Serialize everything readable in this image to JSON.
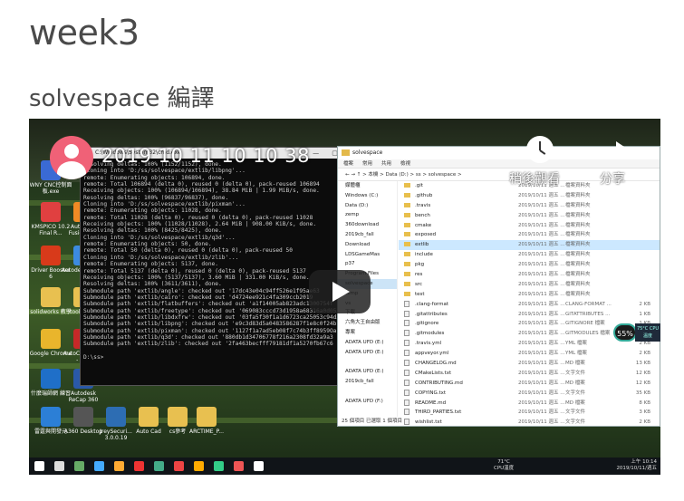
{
  "page": {
    "heading": "week3",
    "subheading": "solvespace 編譯"
  },
  "video": {
    "title": "2019 10 11 10 10 38",
    "watch_later_label": "稍後觀看",
    "share_label": "分享"
  },
  "cmd": {
    "title": "C:\\Windows\\System32\\cmd.exe",
    "lines": [
      "Resolving deltas: 100% (1152/1152), done.",
      "Cloning into 'D:/ss/solvespace/extlib/libpng'...",
      "remote: Enumerating objects: 106894, done.",
      "remote: Total 106894 (delta 0), reused 0 (delta 0), pack-reused 106894",
      "Receiving objects: 100% (106894/106894), 38.84 MiB | 1.99 MiB/s, done.",
      "Resolving deltas: 100% (96837/96837), done.",
      "Cloning into 'D:/ss/solvespace/extlib/pixman'...",
      "remote: Enumerating objects: 11028, done.",
      "remote: Total 11028 (delta 0), reused 0 (delta 0), pack-reused 11028",
      "Receiving objects: 100% (11028/11028), 2.64 MiB | 908.00 KiB/s, done.",
      "Resolving deltas: 100% (8425/8425), done.",
      "Cloning into 'D:/ss/solvespace/extlib/q3d'...",
      "remote: Enumerating objects: 50, done.",
      "remote: Total 50 (delta 0), reused 0 (delta 0), pack-reused 50",
      "Cloning into 'D:/ss/solvespace/extlib/zlib'...",
      "remote: Enumerating objects: 5137, done.",
      "remote: Total 5137 (delta 0), reused 0 (delta 0), pack-reused 5137",
      "Receiving objects: 100% (5137/5137), 3.60 MiB | 331.00 KiB/s, done.",
      "Resolving deltas: 100% (3611/3611), done.",
      "Submodule path 'extlib/angle': checked out '17dc43e04c94ff526e1f95ae63",
      "Submodule path 'extlib/cairo': checked out 'd4724ee921c4fa309ccb2019",
      "Submodule path 'extlib/flatbuffers': checked out 'a1f14005ab823adc1300754f",
      "Submodule path 'extlib/freetype': checked out '069083cccd73d1958a68316a0d05",
      "Submodule path 'extlib/libdxfrw': checked out '03fa5f30f1a1d6723ca25053c94d3",
      "Submodule path 'extlib/libpng': checked out 'e9c3d83d5a0483586287f1e8c0f24b",
      "Submodule path 'extlib/pixman': checked out '1127f1a7ad5eb08f7c74b3ff8959Oa",
      "Submodule path 'extlib/q3d': checked out '880db1d34706778f216a2308fd32a9a3",
      "Submodule path 'extlib/zlib': checked out '2fa463becfff79181df1a5270fb67c6",
      "",
      "D:\\ss>"
    ]
  },
  "explorer": {
    "title": "solvespace",
    "ribbon": [
      "檔案",
      "常用",
      "共用",
      "檢視"
    ],
    "path": "← → ↑  > 本機 > Data (D:) > ss > solvespace >",
    "nav": [
      {
        "label": "媒體櫃",
        "selected": false
      },
      {
        "label": "Windows (C:)",
        "selected": false
      },
      {
        "label": "Data (D:)",
        "selected": false
      },
      {
        "label": "zemp",
        "selected": false
      },
      {
        "label": "360download",
        "selected": false
      },
      {
        "label": "2019cb_fall",
        "selected": false
      },
      {
        "label": "Download",
        "selected": false
      },
      {
        "label": "LDSGameMas",
        "selected": false
      },
      {
        "label": "p37",
        "selected": false
      },
      {
        "label": "Program Files",
        "selected": false
      },
      {
        "label": "solvespace",
        "selected": true
      },
      {
        "label": "temp",
        "selected": false
      },
      {
        "label": "vs",
        "selected": false
      },
      {
        "label": "下載",
        "selected": false
      },
      {
        "label": "六角大王自由版",
        "selected": false
      },
      {
        "label": "專案",
        "selected": false
      },
      {
        "label": "ADATA UFD (E:)",
        "selected": false
      },
      {
        "label": "ADATA UFD (E:)",
        "selected": false
      },
      {
        "label": "",
        "selected": false
      },
      {
        "label": "ADATA UFD (E:)",
        "selected": false
      },
      {
        "label": "2019cb_fall",
        "selected": false
      },
      {
        "label": "",
        "selected": false
      },
      {
        "label": "ADATA UFD (F:)",
        "selected": false
      }
    ],
    "rows": [
      {
        "name": ".git",
        "date": "2019/10/11 週五 ...",
        "type": "檔案資料夾",
        "size": "",
        "doc": false,
        "hl": false
      },
      {
        "name": ".github",
        "date": "2019/10/11 週五 ...",
        "type": "檔案資料夾",
        "size": "",
        "doc": false,
        "hl": false
      },
      {
        "name": ".travis",
        "date": "2019/10/11 週五 ...",
        "type": "檔案資料夾",
        "size": "",
        "doc": false,
        "hl": false
      },
      {
        "name": "bench",
        "date": "2019/10/11 週五 ...",
        "type": "檔案資料夾",
        "size": "",
        "doc": false,
        "hl": false
      },
      {
        "name": "cmake",
        "date": "2019/10/11 週五 ...",
        "type": "檔案資料夾",
        "size": "",
        "doc": false,
        "hl": false
      },
      {
        "name": "exposed",
        "date": "2019/10/11 週五 ...",
        "type": "檔案資料夾",
        "size": "",
        "doc": false,
        "hl": false
      },
      {
        "name": "extlib",
        "date": "2019/10/11 週五 ...",
        "type": "檔案資料夾",
        "size": "",
        "doc": false,
        "hl": true
      },
      {
        "name": "include",
        "date": "2019/10/11 週五 ...",
        "type": "檔案資料夾",
        "size": "",
        "doc": false,
        "hl": false
      },
      {
        "name": "pkg",
        "date": "2019/10/11 週五 ...",
        "type": "檔案資料夾",
        "size": "",
        "doc": false,
        "hl": false
      },
      {
        "name": "res",
        "date": "2019/10/11 週五 ...",
        "type": "檔案資料夾",
        "size": "",
        "doc": false,
        "hl": false
      },
      {
        "name": "src",
        "date": "2019/10/11 週五 ...",
        "type": "檔案資料夾",
        "size": "",
        "doc": false,
        "hl": false
      },
      {
        "name": "test",
        "date": "2019/10/11 週五 ...",
        "type": "檔案資料夾",
        "size": "",
        "doc": false,
        "hl": false
      },
      {
        "name": ".clang-format",
        "date": "2019/10/11 週五 ...",
        "type": "CLANG-FORMAT ...",
        "size": "2 KB",
        "doc": true,
        "hl": false
      },
      {
        "name": ".gitattributes",
        "date": "2019/10/11 週五 ...",
        "type": "GITATTRIBUTES ...",
        "size": "1 KB",
        "doc": true,
        "hl": false
      },
      {
        "name": ".gitignore",
        "date": "2019/10/11 週五 ...",
        "type": "GITIGNORE 檔案",
        "size": "1 KB",
        "doc": true,
        "hl": false
      },
      {
        "name": ".gitmodules",
        "date": "2019/10/11 週五 ...",
        "type": "GITMODULES 檔案",
        "size": "2 KB",
        "doc": true,
        "hl": false
      },
      {
        "name": ".travis.yml",
        "date": "2019/10/11 週五 ...",
        "type": "YML 檔案",
        "size": "2 KB",
        "doc": true,
        "hl": false
      },
      {
        "name": "appveyor.yml",
        "date": "2019/10/11 週五 ...",
        "type": "YML 檔案",
        "size": "2 KB",
        "doc": true,
        "hl": false
      },
      {
        "name": "CHANGELOG.md",
        "date": "2019/10/11 週五 ...",
        "type": "MD 檔案",
        "size": "13 KB",
        "doc": true,
        "hl": false
      },
      {
        "name": "CMakeLists.txt",
        "date": "2019/10/11 週五 ...",
        "type": "文字文件",
        "size": "12 KB",
        "doc": true,
        "hl": false
      },
      {
        "name": "CONTRIBUTING.md",
        "date": "2019/10/11 週五 ...",
        "type": "MD 檔案",
        "size": "12 KB",
        "doc": true,
        "hl": false
      },
      {
        "name": "COPYING.txt",
        "date": "2019/10/11 週五 ...",
        "type": "文字文件",
        "size": "35 KB",
        "doc": true,
        "hl": false
      },
      {
        "name": "README.md",
        "date": "2019/10/11 週五 ...",
        "type": "MD 檔案",
        "size": "8 KB",
        "doc": true,
        "hl": false
      },
      {
        "name": "THIRD_PARTIES.txt",
        "date": "2019/10/11 週五 ...",
        "type": "文字文件",
        "size": "3 KB",
        "doc": true,
        "hl": false
      },
      {
        "name": "wishlist.txt",
        "date": "2019/10/11 週五 ...",
        "type": "文字文件",
        "size": "2 KB",
        "doc": true,
        "hl": false
      }
    ],
    "status": "25 個項目    已選取 1 個項目"
  },
  "desktop_icons": [
    {
      "label": "WNY CNC控制面 板.exe",
      "color": "#3a6ad4"
    },
    {
      "label": "KMSPICO 10.2 Final R...",
      "color": "#e04040"
    },
    {
      "label": "Driver Booster 6",
      "color": "#d83a1a"
    },
    {
      "label": "solidworks 教學",
      "color": "#e8c050"
    },
    {
      "label": "Google Chrome",
      "color": "#e9b52c"
    },
    {
      "label": "什麼瑞師網 練習",
      "color": "#1f6fc8"
    },
    {
      "label": "雷霆與開發元",
      "color": "#2c7fd6"
    },
    {
      "label": "Autodesk Fusion 360",
      "color": "#f08a24"
    },
    {
      "label": "Autodesk 雲端體育",
      "color": "#3c8be0"
    },
    {
      "label": "toolbyyen",
      "color": "#e8c050"
    },
    {
      "label": "AutoCAD 2017 - 繁...",
      "color": "#c62828"
    },
    {
      "label": "Autodesk ReCap 360",
      "color": "#2a59a8"
    },
    {
      "label": "A360 Desktop",
      "color": "#555"
    },
    {
      "label": "JreySecuri... 3.0.0.19",
      "color": "#2d6db3"
    },
    {
      "label": "Auto Cad",
      "color": "#e8c050"
    },
    {
      "label": "cs參考",
      "color": "#e8c050"
    },
    {
      "label": "ARCTIME_P...",
      "color": "#e8c050"
    }
  ],
  "gauge": {
    "value": "55%",
    "label": "75°C CPU溫度"
  },
  "taskbar": {
    "temp": "71°C\nCPU溫度",
    "time": "上午 10:14",
    "date": "2019/10/11/週五",
    "icons": [
      "#fff",
      "#ddd",
      "#6a6",
      "#4af",
      "#fa3",
      "#e33",
      "#4a8",
      "#e44",
      "#fa0",
      "#3c8",
      "#e55",
      "#fff"
    ]
  },
  "colors": {
    "accent": "#f06177",
    "highlight": "#cce8ff"
  }
}
